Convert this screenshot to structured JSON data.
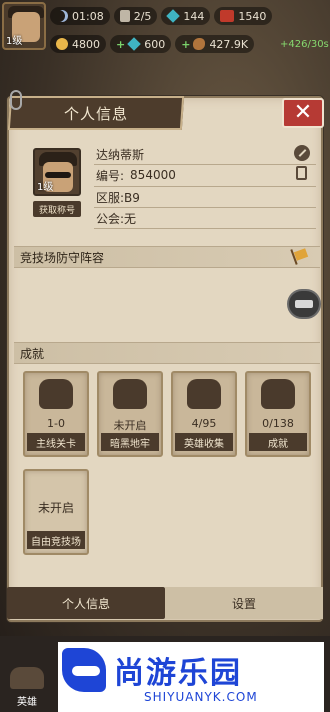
{
  "hud": {
    "level": "1级",
    "time": "01:08",
    "cards": "2/5",
    "gems_top": "144",
    "red_value": "1540",
    "coins": "4800",
    "gems": "600",
    "wood": "427.9K",
    "income": "+426/30s"
  },
  "panel": {
    "title": "个人信息",
    "close_label": "✕"
  },
  "profile": {
    "avatar_level": "1级",
    "get_title_button": "获取称号",
    "name": "达纳蒂斯",
    "id_label": "编号:",
    "id_value": "854000",
    "server": "区服:B9",
    "guild": "公会:无"
  },
  "arena_section": {
    "title": "竞技场防守阵容"
  },
  "achievements": {
    "title": "成就",
    "cards": [
      {
        "value": "1-0",
        "label": "主线关卡"
      },
      {
        "value": "未开启",
        "label": "暗黑地牢"
      },
      {
        "value": "4/95",
        "label": "英雄收集"
      },
      {
        "value": "0/138",
        "label": "成就"
      },
      {
        "value": "未开启",
        "label": "自由竞技场"
      }
    ]
  },
  "tabs": {
    "profile": "个人信息",
    "settings": "设置"
  },
  "bottom": {
    "hero_label": "英雄"
  },
  "watermark": {
    "name": "尚游乐园",
    "url": "SHIYUANYK.COM"
  },
  "colors": {
    "panel_bg": "#e3d7c1",
    "dark_brown": "#4a3a2c",
    "close_red": "#b63a34",
    "logo_blue": "#1e45d6"
  }
}
